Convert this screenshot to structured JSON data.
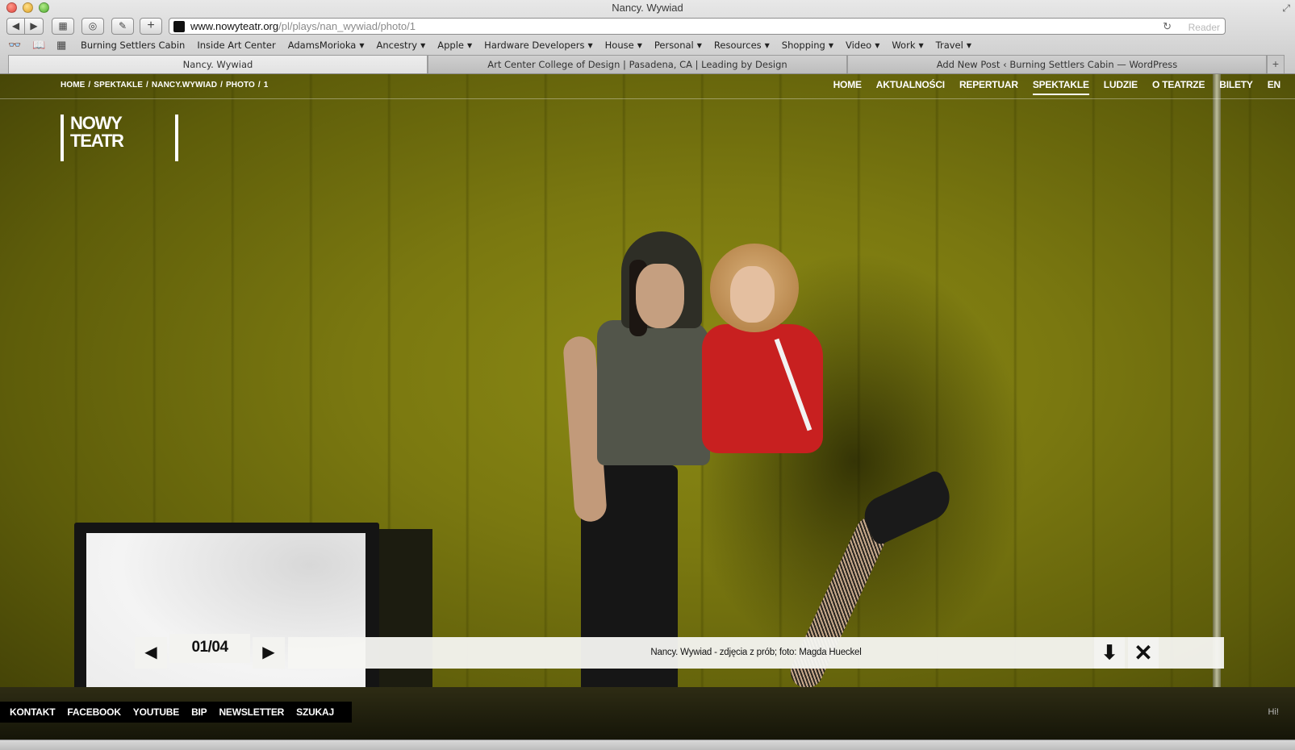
{
  "window": {
    "title": "Nancy. Wywiad"
  },
  "toolbar": {
    "back_icon": "back-arrow-icon",
    "forward_icon": "forward-arrow-icon",
    "url_host": "www.nowyteatr.org",
    "url_path": "/pl/plays/nan_wywiad/photo/1",
    "reader_label": "Reader"
  },
  "bookmarks": [
    {
      "label": "Burning Settlers Cabin",
      "menu": false
    },
    {
      "label": "Inside Art Center",
      "menu": false
    },
    {
      "label": "AdamsMorioka",
      "menu": true
    },
    {
      "label": "Ancestry",
      "menu": true
    },
    {
      "label": "Apple",
      "menu": true
    },
    {
      "label": "Hardware Developers",
      "menu": true
    },
    {
      "label": "House",
      "menu": true
    },
    {
      "label": "Personal",
      "menu": true
    },
    {
      "label": "Resources",
      "menu": true
    },
    {
      "label": "Shopping",
      "menu": true
    },
    {
      "label": "Video",
      "menu": true
    },
    {
      "label": "Work",
      "menu": true
    },
    {
      "label": "Travel",
      "menu": true
    }
  ],
  "tabs": [
    {
      "label": "Nancy. Wywiad",
      "active": true
    },
    {
      "label": "Art Center College of Design | Pasadena, CA | Leading by Design",
      "active": false
    },
    {
      "label": "Add New Post ‹ Burning Settlers Cabin — WordPress",
      "active": false
    }
  ],
  "site": {
    "breadcrumb": [
      "HOME",
      "/",
      "SPEKTAKLE",
      "/",
      "NANCY.WYWIAD",
      "/",
      "PHOTO",
      "/",
      "1"
    ],
    "nav": [
      {
        "label": "HOME",
        "active": false
      },
      {
        "label": "AKTUALNOŚCI",
        "active": false
      },
      {
        "label": "REPERTUAR",
        "active": false
      },
      {
        "label": "SPEKTAKLE",
        "active": true
      },
      {
        "label": "LUDZIE",
        "active": false
      },
      {
        "label": "O TEATRZE",
        "active": false
      },
      {
        "label": "BILETY",
        "active": false
      },
      {
        "label": "EN",
        "active": false
      }
    ],
    "logo_line1": "NOWY",
    "logo_line2": "TEATR"
  },
  "gallery": {
    "counter": "01/04",
    "caption": "Nancy. Wywiad - zdjęcia z prób; foto: Magda Hueckel",
    "prev_glyph": "◀",
    "next_glyph": "▶",
    "download_glyph": "🡇",
    "close_glyph": "✕"
  },
  "footer": {
    "links": [
      "KONTAKT",
      "FACEBOOK",
      "YOUTUBE",
      "BIP",
      "NEWSLETTER",
      "SZUKAJ"
    ],
    "hi": "Hi!"
  },
  "colors": {
    "stage_background": "#7a7810",
    "footer_bg": "#000000",
    "jacket_red": "#c82020"
  }
}
